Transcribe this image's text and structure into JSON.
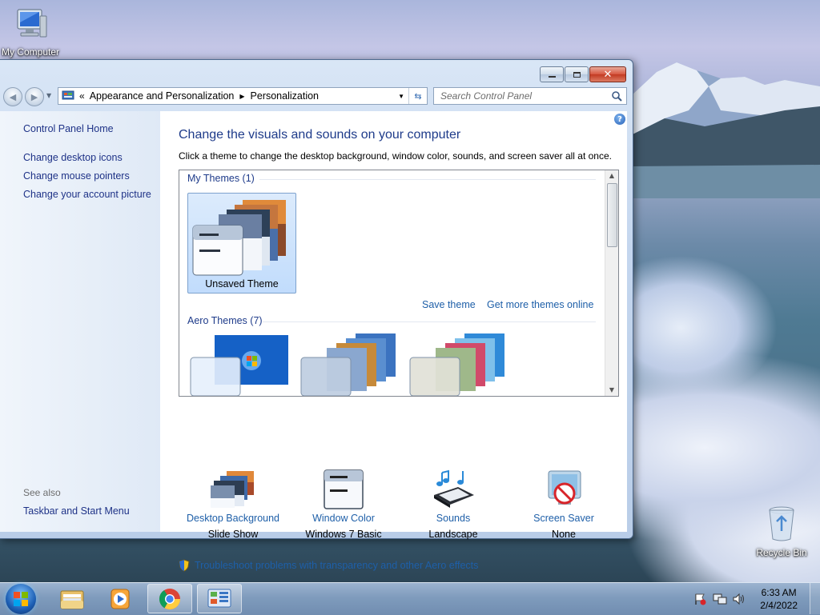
{
  "desktop": {
    "icons": [
      {
        "label": "My Computer"
      },
      {
        "label": "Recycle Bin"
      }
    ]
  },
  "window": {
    "caption_buttons": {
      "minimize": "minimize",
      "maximize": "maximize",
      "close": "close"
    },
    "address": {
      "overflow": "«",
      "crumbs": [
        "Appearance and Personalization",
        "Personalization"
      ]
    },
    "search": {
      "placeholder": "Search Control Panel"
    },
    "left_pane": {
      "home": "Control Panel Home",
      "links": [
        "Change desktop icons",
        "Change mouse pointers",
        "Change your account picture"
      ],
      "see_also_label": "See also",
      "see_also_links": [
        "Taskbar and Start Menu"
      ]
    },
    "main": {
      "title": "Change the visuals and sounds on your computer",
      "subtitle": "Click a theme to change the desktop background, window color, sounds, and screen saver all at once.",
      "groups": [
        {
          "label": "My Themes (1)",
          "themes": [
            {
              "name": "Unsaved Theme",
              "selected": true
            }
          ]
        },
        {
          "label": "Aero Themes (7)"
        }
      ],
      "save_theme": "Save theme",
      "get_more": "Get more themes online",
      "bottom": [
        {
          "link": "Desktop Background",
          "value": "Slide Show",
          "icon": "desktop-background-icon"
        },
        {
          "link": "Window Color",
          "value": "Windows 7 Basic",
          "icon": "window-color-icon"
        },
        {
          "link": "Sounds",
          "value": "Landscape",
          "icon": "sounds-icon"
        },
        {
          "link": "Screen Saver",
          "value": "None",
          "icon": "screen-saver-icon"
        }
      ],
      "troubleshoot": "Troubleshoot problems with transparency and other Aero effects"
    }
  },
  "taskbar": {
    "apps": [
      {
        "name": "start-button"
      },
      {
        "name": "windows-explorer"
      },
      {
        "name": "media-player"
      },
      {
        "name": "chrome"
      },
      {
        "name": "control-panel"
      }
    ],
    "clock": {
      "time": "6:33 AM",
      "date": "2/4/2022"
    }
  },
  "colors": {
    "link": "#1e5fa8",
    "heading": "#1e3b8a",
    "selection": "#c1dcfc"
  }
}
